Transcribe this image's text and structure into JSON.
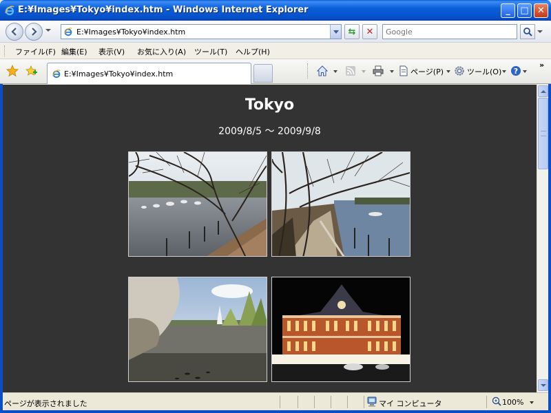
{
  "window": {
    "title": "E:¥Images¥Tokyo¥index.htm - Windows Internet Explorer",
    "minimize_glyph": "_",
    "maximize_glyph": "□",
    "close_glyph": "✕"
  },
  "address_bar": {
    "url": "E:¥Images¥Tokyo¥index.htm",
    "refresh_glyph": "⇆",
    "stop_glyph": "✕"
  },
  "search": {
    "placeholder": "Google"
  },
  "menu": {
    "items": [
      "ファイル(F)",
      "編集(E)",
      "表示(V)",
      "お気に入り(A)",
      "ツール(T)",
      "ヘルプ(H)"
    ]
  },
  "tab": {
    "label": "E:¥Images¥Tokyo¥index.htm"
  },
  "command_bar": {
    "page_label": "ページ(P)",
    "tools_label": "ツール(O)",
    "more_glyph": "»"
  },
  "page": {
    "title": "Tokyo",
    "dates": "2009/8/5 〜 2009/9/8",
    "background": "#333333"
  },
  "photos": [
    {
      "name": "park-pond-boats"
    },
    {
      "name": "lakeside-path-trees"
    },
    {
      "name": "pond-fountain-blossoms"
    },
    {
      "name": "tokyo-station-night"
    }
  ],
  "status": {
    "text": "ページが表示されました",
    "zone": "マイ コンピュータ",
    "zoom": "100%"
  },
  "icons": {
    "back": "back-arrow-icon",
    "forward": "forward-arrow-icon",
    "favorites": "star-icon",
    "add_favorites": "add-favorite-icon",
    "home": "home-icon",
    "feeds": "rss-icon",
    "print": "printer-icon",
    "page": "page-icon",
    "tools": "gear-icon",
    "help": "help-icon"
  },
  "colors": {
    "titlebar": "#0a5fd8",
    "content_bg": "#333333",
    "status_bg": "#ece9d8"
  }
}
